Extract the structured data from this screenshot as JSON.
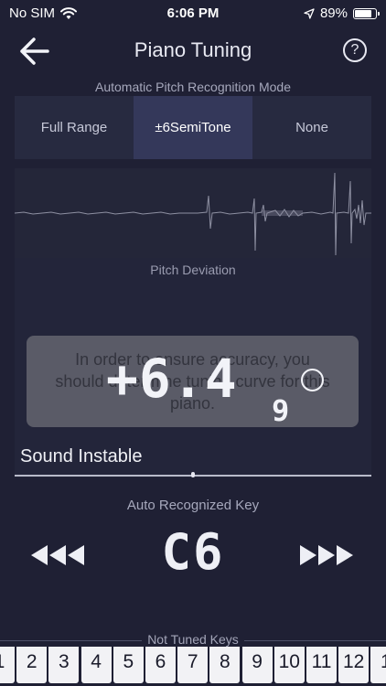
{
  "status": {
    "carrier": "No SIM",
    "time": "6:06 PM",
    "battery_percent": "89%",
    "battery_level": 0.89,
    "icons": [
      "wifi-icon",
      "location-arrow-icon",
      "battery-icon"
    ]
  },
  "nav": {
    "title": "Piano Tuning",
    "back_icon": "arrow-left-icon",
    "help_label": "?"
  },
  "mode": {
    "label": "Automatic Pitch Recognition Mode",
    "options": [
      "Full Range",
      "±6SemiTone",
      "None"
    ],
    "selected": "±6SemiTone"
  },
  "deviation": {
    "label": "Pitch Deviation",
    "value": "+6.4",
    "sub_digit": "9",
    "toast": "In order to ensure accuracy, you should determine tuning curve for this piano.",
    "sound_status": "Sound Instable",
    "needle_fraction": 0.5
  },
  "recognized": {
    "label": "Auto Recognized Key",
    "key": "C6",
    "prev_icon": "triple-left-arrow-icon",
    "next_icon": "triple-right-arrow-icon"
  },
  "not_tuned": {
    "label": "Not Tuned Keys",
    "keys": [
      "1",
      "2",
      "3",
      "4",
      "5",
      "6",
      "7",
      "8",
      "9",
      "10",
      "11",
      "12",
      "1"
    ]
  },
  "colors": {
    "background": "#1f2034",
    "panel": "#242639",
    "segment_active": "#34385a",
    "key_white": "#f2f2f5"
  }
}
